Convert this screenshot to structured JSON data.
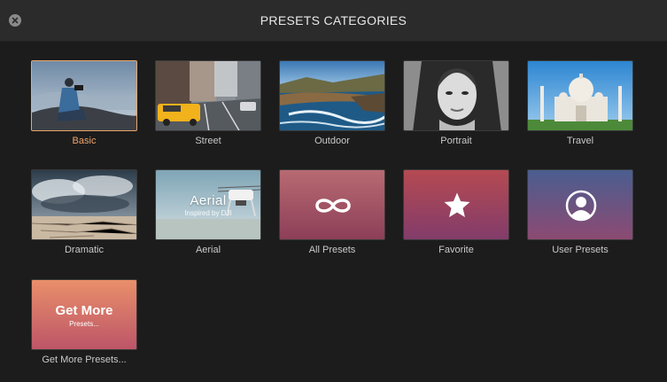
{
  "window": {
    "title": "PRESETS CATEGORIES",
    "close_icon": "close-icon"
  },
  "presets": [
    {
      "label": "Basic",
      "selected": true,
      "thumb": "photo"
    },
    {
      "label": "Street",
      "selected": false,
      "thumb": "photo"
    },
    {
      "label": "Outdoor",
      "selected": false,
      "thumb": "photo"
    },
    {
      "label": "Portrait",
      "selected": false,
      "thumb": "photo"
    },
    {
      "label": "Travel",
      "selected": false,
      "thumb": "photo"
    },
    {
      "label": "Dramatic",
      "selected": false,
      "thumb": "photo"
    },
    {
      "label": "Aerial",
      "selected": false,
      "thumb": "photo",
      "overlay_title": "Aerial",
      "overlay_subtitle": "Inspired by DJI"
    },
    {
      "label": "All Presets",
      "selected": false,
      "thumb": "gradient",
      "icon": "infinity-icon"
    },
    {
      "label": "Favorite",
      "selected": false,
      "thumb": "gradient",
      "icon": "star-icon"
    },
    {
      "label": "User Presets",
      "selected": false,
      "thumb": "gradient",
      "icon": "user-icon"
    },
    {
      "label": "Get More Presets...",
      "selected": false,
      "thumb": "gradient",
      "overlay_title": "Get More",
      "overlay_subtitle": "Presets..."
    }
  ],
  "colors": {
    "selected_accent": "#f0a46a",
    "all_presets_gradient": [
      "#b4606b",
      "#8a3f57"
    ],
    "favorite_gradient": [
      "#b14a52",
      "#7f3a6a"
    ],
    "user_presets_gradient": [
      "#4a5c8c",
      "#8a4a72"
    ],
    "get_more_gradient": [
      "#e88a68",
      "#b85566"
    ]
  }
}
